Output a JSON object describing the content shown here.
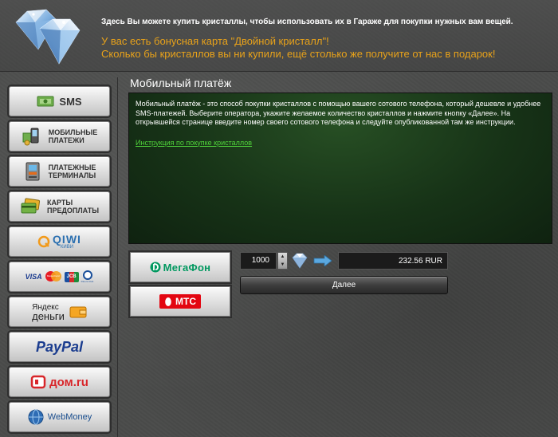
{
  "header": {
    "info": "Здесь Вы можете купить кристаллы, чтобы использовать их в Гараже для покупки нужных вам вещей.",
    "bonus_line1": "У вас есть бонусная карта \"Двойной кристалл\"!",
    "bonus_line2": "Сколько бы кристаллов вы ни купили, ещё столько же получите от нас в подарок!"
  },
  "sidebar": {
    "items": [
      {
        "label": "SMS",
        "icon": "sms-money-icon"
      },
      {
        "label1": "Мобильные",
        "label2": "платежи",
        "icon": "mobile-payments-icon"
      },
      {
        "label1": "Платежные",
        "label2": "терминалы",
        "icon": "terminal-icon"
      },
      {
        "label1": "Карты",
        "label2": "предоплаты",
        "icon": "prepaid-card-icon"
      },
      {
        "label": "QIWI",
        "sub": "КИВИ",
        "icon": "qiwi-logo"
      },
      {
        "labels": [
          "VISA",
          "MasterCard",
          "JCB",
          "Diners Club"
        ],
        "icon": "cards-logos"
      },
      {
        "label1": "Яндекс",
        "label2": "деньги",
        "icon": "yandex-money-logo"
      },
      {
        "label": "PayPal",
        "icon": "paypal-logo"
      },
      {
        "label": "дом.ru",
        "icon": "domru-logo"
      },
      {
        "label": "WebMoney",
        "icon": "webmoney-logo"
      }
    ]
  },
  "main": {
    "title": "Мобильный платёж",
    "description": "Мобильный платёж - это способ покупки кристаллов с помощью вашего сотового телефона, который дешевле и удобнее SMS-платежей. Выберите оператора, укажите желаемое количество кристаллов и нажмите кнопку «Далее». На открывшейся странице введите номер своего сотового телефона и следуйте опубликованной там же инструкции.",
    "link": "Инструкция по покупке кристаллов"
  },
  "operators": [
    {
      "label": "МегаФон",
      "icon": "megafon-logo"
    },
    {
      "label": "МТС",
      "icon": "mts-logo"
    }
  ],
  "purchase": {
    "amount": "1000",
    "price": "232.56 RUR",
    "next_label": "Далее"
  },
  "colors": {
    "accent_orange": "#e8a21a",
    "link_green": "#4fd33a",
    "panel_green": "#1f3f1d",
    "megafon_green": "#00985f",
    "mts_red": "#e30611"
  }
}
